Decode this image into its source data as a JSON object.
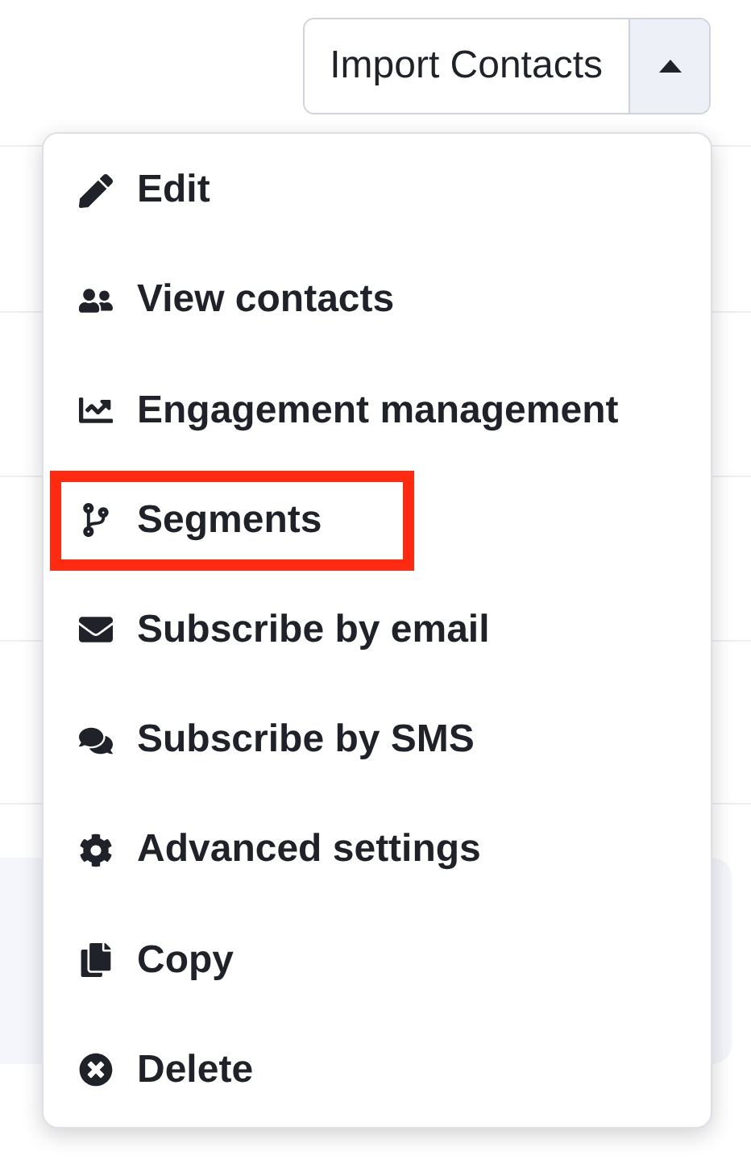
{
  "import_button": {
    "label": "Import Contacts",
    "menu_open": true
  },
  "menu": [
    {
      "label": "Edit",
      "highlighted": false
    },
    {
      "label": "View contacts",
      "highlighted": false
    },
    {
      "label": "Engagement management",
      "highlighted": false
    },
    {
      "label": "Segments",
      "highlighted": true
    },
    {
      "label": "Subscribe by email",
      "highlighted": false
    },
    {
      "label": "Subscribe by SMS",
      "highlighted": false
    },
    {
      "label": "Advanced settings",
      "highlighted": false
    },
    {
      "label": "Copy",
      "highlighted": false
    },
    {
      "label": "Delete",
      "highlighted": false
    }
  ]
}
